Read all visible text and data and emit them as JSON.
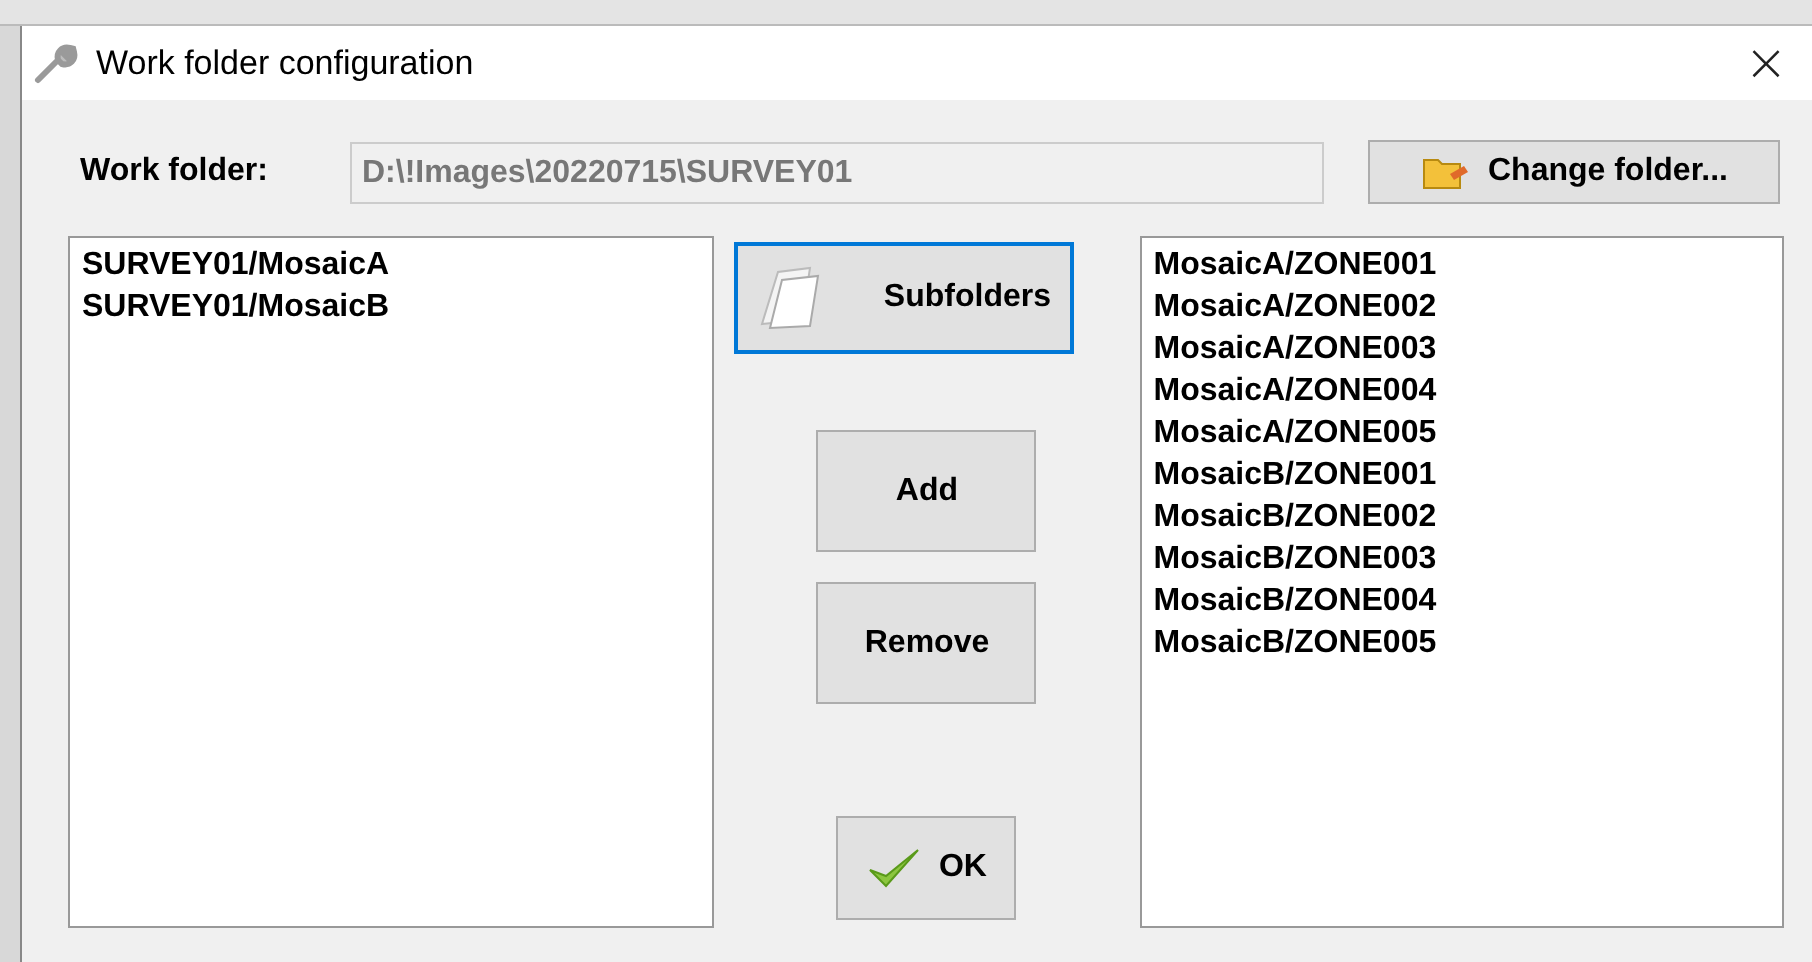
{
  "window": {
    "title": "Work folder configuration",
    "close": "×"
  },
  "work_folder": {
    "label": "Work folder:",
    "value": "D:\\!Images\\20220715\\SURVEY01",
    "disabled": true
  },
  "change_button": {
    "label": "Change folder...",
    "focused": false
  },
  "left_list": {
    "items": [
      "SURVEY01/MosaicA",
      "SURVEY01/MosaicB"
    ]
  },
  "buttons": [
    {
      "kind": "subfolders",
      "label": "Subfolders",
      "focused": true
    },
    {
      "kind": "add",
      "label": "Add",
      "focused": false
    },
    {
      "kind": "remove",
      "label": "Remove",
      "focused": false
    },
    {
      "kind": "ok",
      "label": "OK",
      "focused": false
    }
  ],
  "right_list": {
    "items": [
      "MosaicA/ZONE001",
      "MosaicA/ZONE002",
      "MosaicA/ZONE003",
      "MosaicA/ZONE004",
      "MosaicA/ZONE005",
      "MosaicB/ZONE001",
      "MosaicB/ZONE002",
      "MosaicB/ZONE003",
      "MosaicB/ZONE004",
      "MosaicB/ZONE005"
    ]
  }
}
